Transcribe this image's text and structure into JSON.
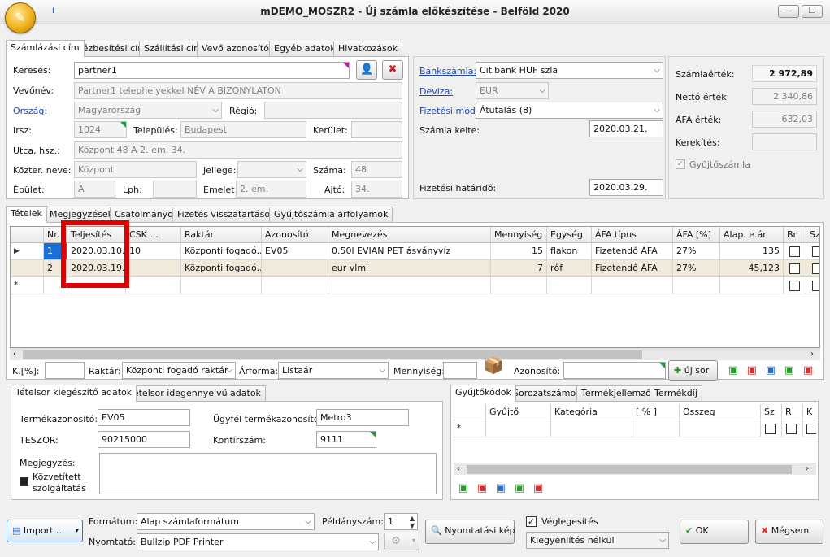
{
  "window": {
    "title": "mDEMO_MOSZR2 - Új számla előkészítése - Belföld 2020",
    "info_icon": "info-icon",
    "min_label": "—",
    "restore_label": "❐"
  },
  "top_tabs": [
    "Számlázási cím",
    "Kézbesítési cím",
    "Szállítási cím",
    "Vevő azonosítók",
    "Egyéb adatok",
    "Hivatkozások"
  ],
  "address": {
    "search_label": "Keresés:",
    "search_value": "partner1",
    "buyer_label": "Vevőnév:",
    "buyer_value": "Partner1 telephelyekkel NÉV A BIZONYLATON",
    "country_label": "Ország:",
    "country_value": "Magyarország",
    "region_label": "Régió:",
    "region_value": "",
    "zip_label": "Irsz:",
    "zip_value": "1024",
    "city_label": "Település:",
    "city_value": "Budapest",
    "district_label": "Kerület:",
    "district_value": "",
    "street_label": "Utca, hsz.:",
    "street_value": "Központ 48 A 2. em. 34.",
    "pubname_label": "Közter. neve:",
    "pubname_value": "Központ",
    "type_label": "Jellege:",
    "type_value": "",
    "number_label": "Száma:",
    "number_value": "48",
    "building_label": "Épület:",
    "building_value": "A",
    "stair_label": "Lph:",
    "stair_value": "",
    "floor_label": "Emelet:",
    "floor_value": "2. em.",
    "door_label": "Ajtó:",
    "door_value": "34."
  },
  "payment": {
    "bank_label": "Bankszámla:",
    "bank_value": "Citibank HUF szla",
    "currency_label": "Deviza:",
    "currency_value": "EUR",
    "method_label": "Fizetési mód:",
    "method_value": "Átutalás (8)",
    "date_label": "Számla kelte:",
    "date_value": "2020.03.21.",
    "due_label": "Fizetési határidő:",
    "due_value": "2020.03.29."
  },
  "totals": {
    "invoice_label": "Számlaérték:",
    "invoice_value": "2 972,89",
    "net_label": "Nettó érték:",
    "net_value": "2 340,86",
    "vat_label": "ÁFA érték:",
    "vat_value": "632,03",
    "rounding_label": "Kerekítés:",
    "rounding_value": "",
    "collective_label": "Gyűjtőszámla"
  },
  "item_tabs": [
    "Tételek",
    "Megjegyzések",
    "Csatolmányok",
    "Fizetés visszatartások",
    "Gyűjtőszámla árfolyamok"
  ],
  "grid": {
    "headers": [
      "Nr.",
      "Teljesítés",
      "CSK ...",
      "Raktár",
      "Azonosító",
      "Megnevezés",
      "Mennyiség",
      "Egység",
      "ÁFA típus",
      "ÁFA [%]",
      "Alap. e.ár",
      "Br",
      "Sz"
    ],
    "rows": [
      {
        "nr": "1",
        "date": "2020.03.10.",
        "csk": "10",
        "warehouse": "Központi fogadó...",
        "id": "EV05",
        "name": "0.50l EVIAN PET ásványvíz",
        "qty": "15",
        "unit": "flakon",
        "vat_type": "Fizetendő ÁFA",
        "vat_pct": "27%",
        "price": "135"
      },
      {
        "nr": "2",
        "date": "2020.03.19.",
        "csk": "",
        "warehouse": "Központi fogadó...",
        "id": "",
        "name": "eur vlmi",
        "qty": "7",
        "unit": "rőf",
        "vat_type": "Fizetendő ÁFA",
        "vat_pct": "27%",
        "price": "45,123"
      }
    ],
    "new_row_marker": "*"
  },
  "quick_entry": {
    "discount_label": "K.[%]:",
    "discount_value": "",
    "warehouse_label": "Raktár:",
    "warehouse_value": "Központi fogadó raktár",
    "pricetype_label": "Árforma:",
    "pricetype_value": "Listaár",
    "qty_label": "Mennyiség:",
    "qty_value": "",
    "id_label": "Azonosító:",
    "id_value": "",
    "newrow_label": "új sor"
  },
  "detail_tabs": [
    "Tételsor kiegészítő adatok",
    "Tételsor idegennyelvű adatok"
  ],
  "detail": {
    "product_id_label": "Termékazonosító:",
    "product_id_value": "EV05",
    "customer_pid_label": "Ügyfél termékazonosító:",
    "customer_pid_value": "Metro3",
    "teszor_label": "TESZOR:",
    "teszor_value": "90215000",
    "account_label": "Kontírszám:",
    "account_value": "9111",
    "note_label": "Megjegyzés:",
    "mediated_label1": "Közvetített",
    "mediated_label2": "szolgáltatás"
  },
  "code_tabs": [
    "Gyűjtőkódok",
    "Sorozatszámok",
    "Termékjellemzők",
    "Termékdíj"
  ],
  "code_grid": {
    "headers": [
      "Gyűjtő",
      "Kategória",
      "[ % ]",
      "Összeg",
      "Sz",
      "R",
      "K"
    ],
    "new_row_marker": "*"
  },
  "footer": {
    "import_label": "Import ...",
    "format_label": "Formátum:",
    "format_value": "Alap számlaformátum",
    "printer_label": "Nyomtató:",
    "printer_value": "Bullzip PDF Printer",
    "copies_label": "Példányszám:",
    "copies_value": "1",
    "preview_label": "Nyomtatási kép",
    "final_label": "Véglegesítés",
    "settle_value": "Kiegyenlítés nélkül",
    "ok_label": "OK",
    "cancel_label": "Mégsem"
  },
  "colors": {
    "highlight": "#e00000",
    "link": "#1a46b8",
    "selected_row": "#efeadb",
    "nr_selected": "#1c6fd6"
  }
}
